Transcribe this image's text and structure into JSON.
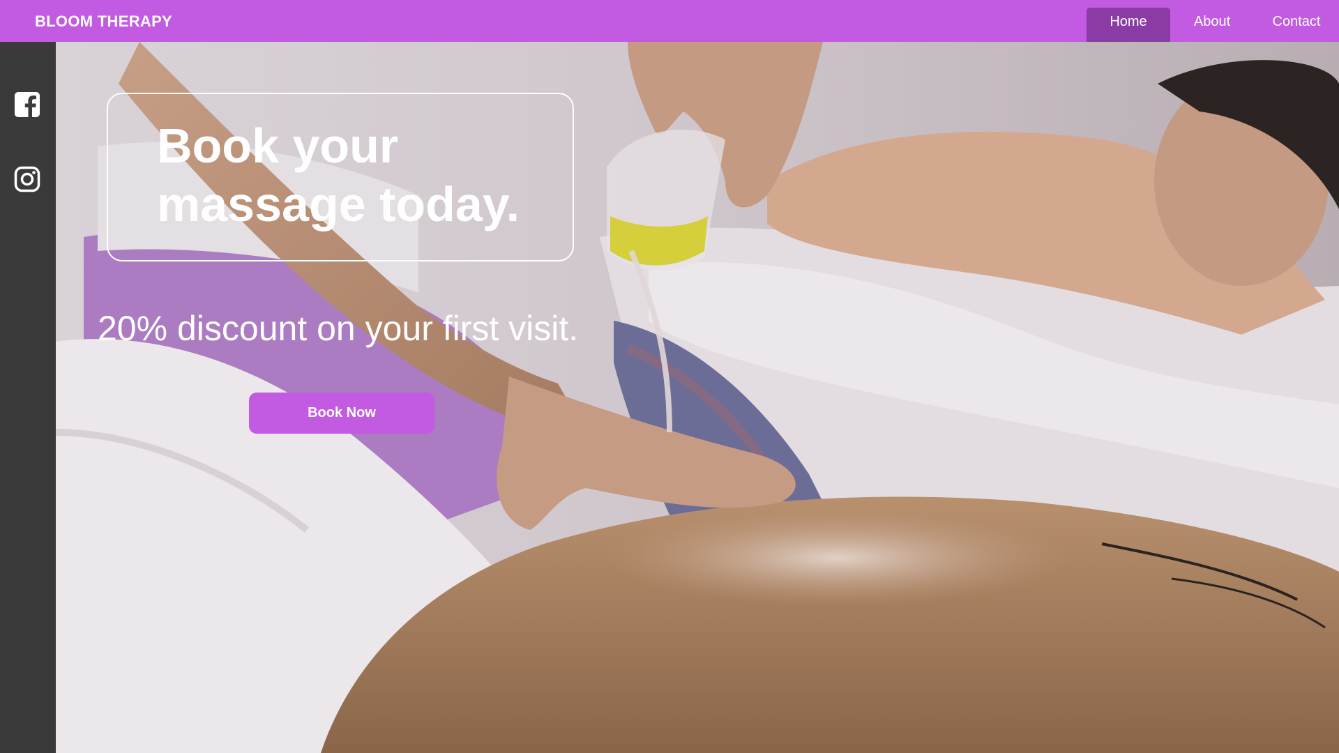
{
  "header": {
    "brand": "BLOOM THERAPY",
    "nav": [
      {
        "label": "Home",
        "active": true
      },
      {
        "label": "About",
        "active": false
      },
      {
        "label": "Contact",
        "active": false
      }
    ]
  },
  "sidebar": {
    "icons": [
      "facebook-icon",
      "instagram-icon"
    ]
  },
  "hero": {
    "headline_line1": "Book your",
    "headline_line2": "massage today.",
    "subline": "20% discount on your first visit.",
    "cta_label": "Book Now",
    "image_subject": "massage-therapy-photo"
  },
  "colors": {
    "brand_purple": "#c25ae2",
    "active_nav": "#8a3ba4",
    "sidebar": "#3a3a3a",
    "text": "#ffffff"
  }
}
